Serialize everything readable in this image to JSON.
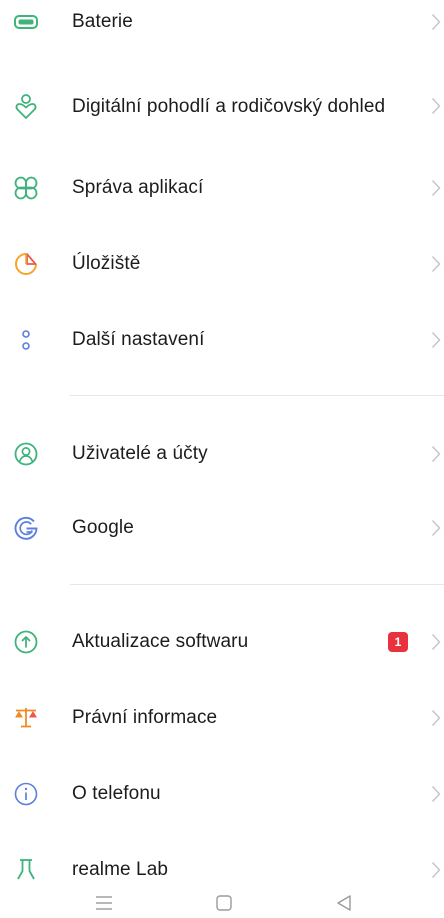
{
  "settings": {
    "items": [
      {
        "label": "Baterie",
        "icon": "battery-icon"
      },
      {
        "label": "Digitální pohodlí a rodičovský dohled",
        "icon": "digital-wellbeing-icon"
      },
      {
        "label": "Správa aplikací",
        "icon": "app-management-icon"
      },
      {
        "label": "Úložiště",
        "icon": "storage-icon"
      },
      {
        "label": "Další nastavení",
        "icon": "more-settings-icon"
      },
      {
        "label": "Uživatelé a účty",
        "icon": "users-accounts-icon"
      },
      {
        "label": "Google",
        "icon": "google-icon"
      },
      {
        "label": "Aktualizace softwaru",
        "icon": "software-update-icon",
        "badge": "1"
      },
      {
        "label": "Právní informace",
        "icon": "legal-info-icon"
      },
      {
        "label": "O telefonu",
        "icon": "about-phone-icon"
      },
      {
        "label": "realme Lab",
        "icon": "realme-lab-icon"
      }
    ]
  },
  "colors": {
    "accent_green": "#3fb47a",
    "google_blue": "#5b7fe0",
    "storage_orange": "#f4a629",
    "storage_red": "#ec5a4e",
    "legal_orange": "#f08a24",
    "badge_red": "#e8333f",
    "chevron_gray": "#c4c4c4",
    "divider_gray": "#e6e6e6"
  },
  "navbar": {
    "buttons": [
      "menu-icon",
      "home-icon",
      "back-icon"
    ]
  }
}
